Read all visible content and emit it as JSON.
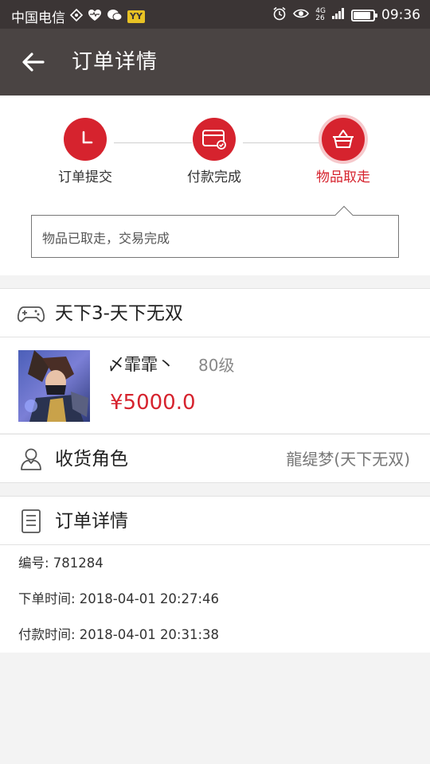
{
  "status_bar": {
    "carrier": "中国电信",
    "yy_badge": "YY",
    "network_top": "4G",
    "network_bottom": "26",
    "time": "09:36",
    "battery_level": 0.9
  },
  "header": {
    "title": "订单详情"
  },
  "progress": {
    "steps": [
      {
        "label": "订单提交",
        "icon": "clock-icon"
      },
      {
        "label": "付款完成",
        "icon": "card-check-icon"
      },
      {
        "label": "物品取走",
        "icon": "basket-icon"
      }
    ],
    "current_step": 3,
    "message": "物品已取走，交易完成"
  },
  "game": {
    "title": "天下3-天下无双",
    "character_name": "〆霏霏丶",
    "level": "80级",
    "price": "¥5000.0"
  },
  "receiver": {
    "label": "收货角色",
    "value": "龍缇梦(天下无双)"
  },
  "order_details": {
    "title": "订单详情",
    "order_number": "编号: 781284",
    "order_time": "下单时间: 2018-04-01 20:27:46",
    "payment_time": "付款时间: 2018-04-01 20:31:38"
  },
  "colors": {
    "accent": "#d6232e",
    "appbar": "#4a4443",
    "statusbar": "#3b3535"
  }
}
